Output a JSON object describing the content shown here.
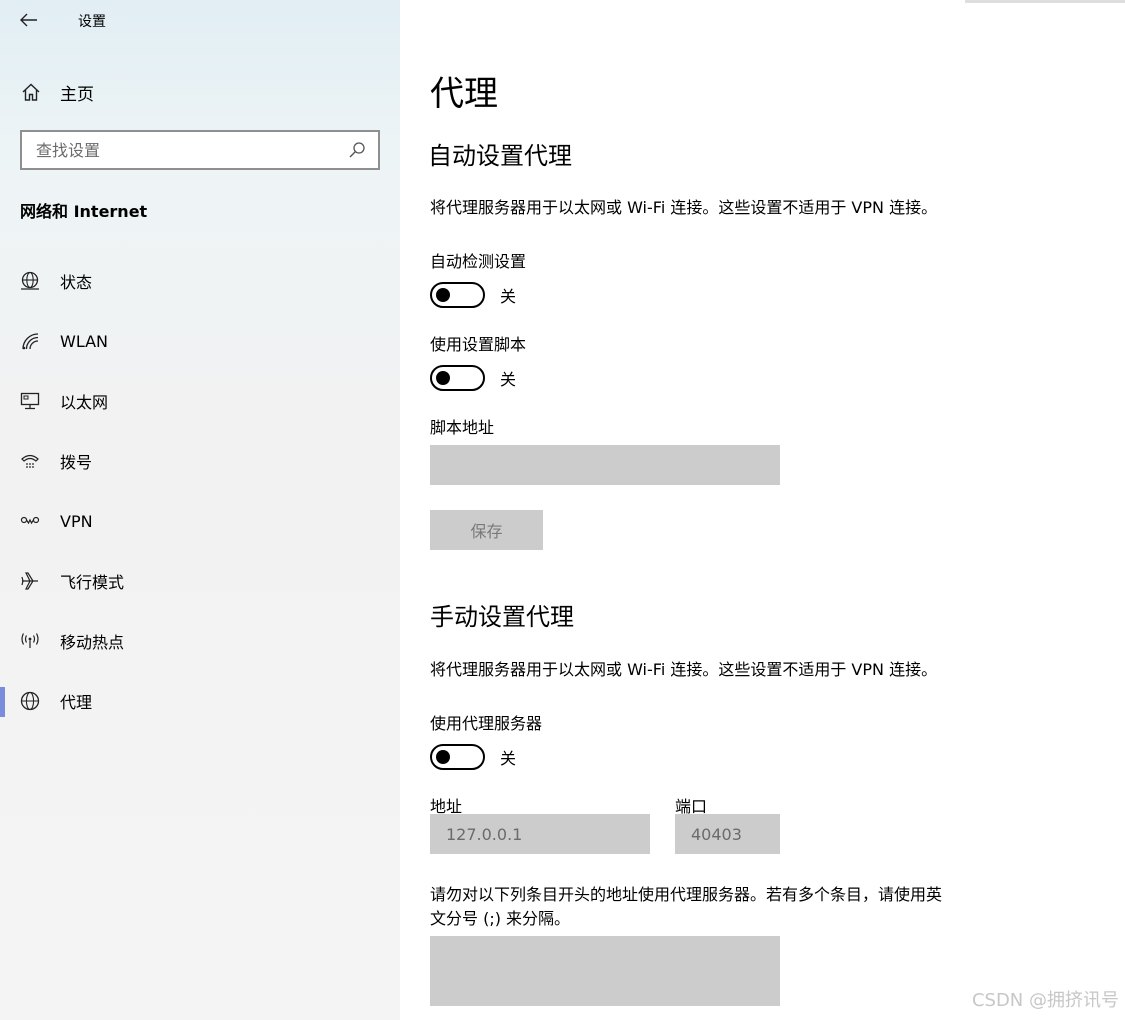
{
  "titlebar": {
    "title": "设置"
  },
  "sidebar": {
    "home_label": "主页",
    "search_placeholder": "查找设置",
    "section_label": "网络和 Internet",
    "items": [
      {
        "label": "状态",
        "icon": "globe-status-icon"
      },
      {
        "label": "WLAN",
        "icon": "wifi-icon"
      },
      {
        "label": "以太网",
        "icon": "ethernet-icon"
      },
      {
        "label": "拨号",
        "icon": "dialup-icon"
      },
      {
        "label": "VPN",
        "icon": "vpn-icon"
      },
      {
        "label": "飞行模式",
        "icon": "airplane-icon"
      },
      {
        "label": "移动热点",
        "icon": "hotspot-icon"
      },
      {
        "label": "代理",
        "icon": "globe-icon",
        "active": true
      }
    ]
  },
  "main": {
    "title": "代理",
    "auto": {
      "heading": "自动设置代理",
      "description": "将代理服务器用于以太网或 Wi-Fi 连接。这些设置不适用于 VPN 连接。",
      "detect_label": "自动检测设置",
      "detect_state": "关",
      "script_label": "使用设置脚本",
      "script_state": "关",
      "script_address_label": "脚本地址",
      "script_address_value": "",
      "save_label": "保存"
    },
    "manual": {
      "heading": "手动设置代理",
      "description": "将代理服务器用于以太网或 Wi-Fi 连接。这些设置不适用于 VPN 连接。",
      "use_proxy_label": "使用代理服务器",
      "use_proxy_state": "关",
      "address_label": "地址",
      "address_value": "127.0.0.1",
      "port_label": "端口",
      "port_value": "40403",
      "exceptions_line1": "请勿对以下列条目开头的地址使用代理服务器。若有多个条目，请使用英",
      "exceptions_line2": "文分号 (;) 来分隔。",
      "exceptions_value": ""
    }
  },
  "watermark": "CSDN @拥挤讯号",
  "colors": {
    "active_indicator": "#7a8cdc",
    "disabled_fill": "#cccccc"
  }
}
